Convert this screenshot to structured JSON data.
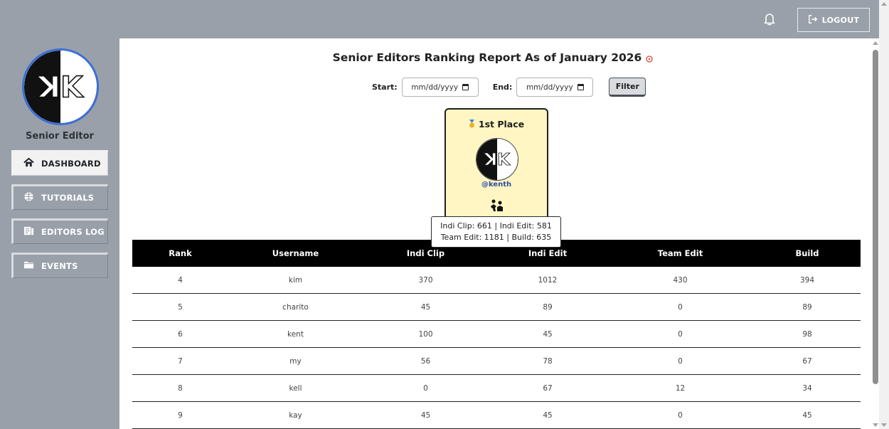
{
  "header": {
    "logout_label": "LOGOUT"
  },
  "sidebar": {
    "role": "Senior Editor",
    "items": [
      {
        "label": "DASHBOARD"
      },
      {
        "label": "TUTORIALS"
      },
      {
        "label": "EDITORS LOG"
      },
      {
        "label": "EVENTS"
      }
    ]
  },
  "main": {
    "title": "Senior Editors Ranking Report As of January 2026",
    "filter": {
      "start_label": "Start:",
      "start_value": "mm/dd/yyyy",
      "end_label": "End:",
      "end_value": "mm/dd/yyyy",
      "button": "Filter"
    },
    "top": {
      "place": "1st Place",
      "username": "@kenth"
    },
    "tooltip": {
      "line1": "Indi Clip: 661 | Indi Edit: 581",
      "line2": "Team Edit: 1181 | Build: 635"
    },
    "table": {
      "headers": [
        "Rank",
        "Username",
        "Indi Clip",
        "Indi Edit",
        "Team Edit",
        "Build"
      ],
      "rows": [
        [
          "4",
          "kim",
          "370",
          "1012",
          "430",
          "394"
        ],
        [
          "5",
          "charito",
          "45",
          "89",
          "0",
          "89"
        ],
        [
          "6",
          "kent",
          "100",
          "45",
          "0",
          "98"
        ],
        [
          "7",
          "my",
          "56",
          "78",
          "0",
          "67"
        ],
        [
          "8",
          "kell",
          "0",
          "67",
          "12",
          "34"
        ],
        [
          "9",
          "kay",
          "45",
          "45",
          "0",
          "45"
        ]
      ]
    }
  },
  "colors": {
    "sidebar": "#9aa0a9",
    "podium": "#fff6c3",
    "avatar_ring": "#3b6fd8",
    "username": "#2f4ea3"
  },
  "icons": {
    "bell": "bell-icon",
    "logout": "logout-icon",
    "dashboard": "home-icon",
    "tutorials": "globe-icon",
    "editors_log": "log-icon",
    "events": "folder-icon"
  }
}
